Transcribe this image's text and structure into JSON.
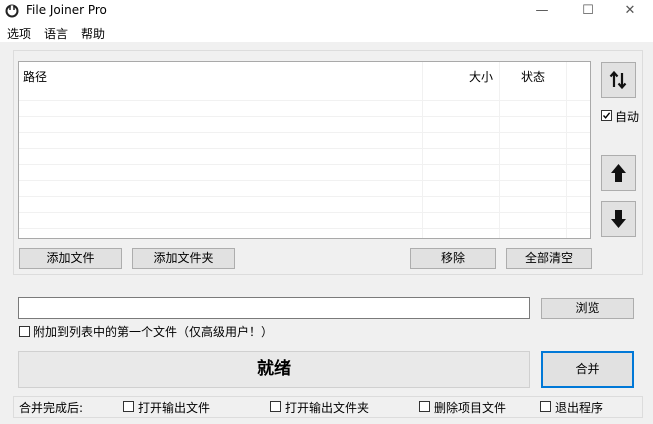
{
  "window": {
    "title": "File Joiner Pro",
    "minimize": "—",
    "maximize": "☐",
    "close": "✕"
  },
  "menu": [
    "选项",
    "语言",
    "帮助"
  ],
  "list": {
    "columns": {
      "path": "路径",
      "size": "大小",
      "status": "状态"
    },
    "rows": []
  },
  "side": {
    "auto_label": "自动",
    "auto_checked": true
  },
  "buttons": {
    "add_file": "添加文件",
    "add_folder": "添加文件夹",
    "remove": "移除",
    "clear_all": "全部清空",
    "browse": "浏览",
    "merge": "合并"
  },
  "output": {
    "path_value": "",
    "append_label": "附加到列表中的第一个文件（仅高级用户！）"
  },
  "status_text": "就绪",
  "after_merge": {
    "label": "合并完成后:",
    "open_output_file": "打开输出文件",
    "open_output_folder": "打开输出文件夹",
    "delete_project_files": "删除项目文件",
    "exit_program": "退出程序"
  },
  "colors": {
    "accent": "#0078d7",
    "window_bg": "#f0f0f0"
  }
}
